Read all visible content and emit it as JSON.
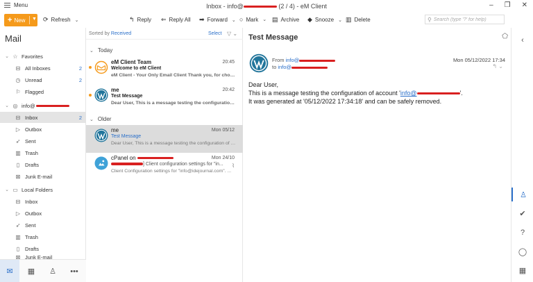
{
  "window": {
    "menu_label": "Menu",
    "title_prefix": "Inbox - info@",
    "title_suffix": "(2 / 4) - eM Client",
    "controls": [
      "–",
      "❐",
      "✕"
    ]
  },
  "toolbar": {
    "new_label": "New",
    "refresh_label": "Refresh",
    "reply_label": "Reply",
    "reply_all_label": "Reply All",
    "forward_label": "Forward",
    "mark_label": "Mark",
    "archive_label": "Archive",
    "snooze_label": "Snooze",
    "delete_label": "Delete",
    "search_placeholder": "Search (type '?' for help)"
  },
  "sidebar": {
    "title": "Mail",
    "favorites_label": "Favorites",
    "favorites": [
      {
        "label": "All Inboxes",
        "count": "2",
        "icon": "inbox-icon"
      },
      {
        "label": "Unread",
        "count": "2",
        "icon": "clock-icon"
      },
      {
        "label": "Flagged",
        "count": "",
        "icon": "flag-icon"
      }
    ],
    "account_label": "info@",
    "account": [
      {
        "label": "Inbox",
        "count": "2",
        "icon": "inbox-icon"
      },
      {
        "label": "Outbox",
        "count": "",
        "icon": "outbox-icon"
      },
      {
        "label": "Sent",
        "count": "",
        "icon": "sent-icon"
      },
      {
        "label": "Trash",
        "count": "",
        "icon": "trash-icon"
      },
      {
        "label": "Drafts",
        "count": "",
        "icon": "drafts-icon"
      },
      {
        "label": "Junk E-mail",
        "count": "",
        "icon": "junk-icon"
      }
    ],
    "local_label": "Local Folders",
    "local": [
      {
        "label": "Inbox",
        "icon": "inbox-icon"
      },
      {
        "label": "Outbox",
        "icon": "outbox-icon"
      },
      {
        "label": "Sent",
        "icon": "sent-icon"
      },
      {
        "label": "Trash",
        "icon": "trash-icon"
      },
      {
        "label": "Drafts",
        "icon": "drafts-icon"
      },
      {
        "label": "Junk E-mail",
        "icon": "junk-icon"
      }
    ],
    "bottom": [
      "mail-icon",
      "calendar-icon",
      "contacts-icon",
      "more-icon"
    ]
  },
  "list": {
    "sorted_by_prefix": "Sorted by ",
    "sorted_by_field": "Received",
    "select_label": "Select",
    "groups": {
      "today": "Today",
      "older": "Older"
    },
    "messages": [
      {
        "from": "eM Client Team",
        "date": "20:45",
        "subject": "Welcome to eM Client",
        "preview": "eM Client - Your Only Email Client Thank you, for choosi...",
        "unread": true
      },
      {
        "from": "me",
        "date": "20:42",
        "subject": "Test Message",
        "preview": "Dear User, This is a message testing the configuration ...",
        "unread": true
      },
      {
        "from": "me",
        "date": "Mon 05/12",
        "subject": "Test Message",
        "preview": "Dear User, This is a message testing the configuration of a...",
        "unread": false
      },
      {
        "from": "cPanel on ",
        "date": "Mon 24/10",
        "subject": "] Client configuration settings for \"in...",
        "preview": "Client Configuration settings for \"info@idejournal.com\". ...",
        "unread": false
      }
    ]
  },
  "reader": {
    "subject": "Test Message",
    "from_label": "From ",
    "from_addr": "info@",
    "to_label": "to ",
    "to_addr": "info@",
    "date": "Mon 05/12/2022 17:34",
    "greeting": "Dear User,",
    "line1_prefix": "This is a message testing the configuration of account '",
    "line1_link": "info@",
    "line1_suffix": "'.",
    "line2": "It was generated at '05/12/2022 17:34:18' and can be safely removed."
  },
  "rail": [
    "contact-icon",
    "check-icon",
    "help-icon",
    "chat-icon",
    "calendar-icon"
  ],
  "colors": {
    "accent": "#f59a1b",
    "link": "#2a6fc9",
    "redaction": "#d92020",
    "wordpress": "#21759b"
  }
}
